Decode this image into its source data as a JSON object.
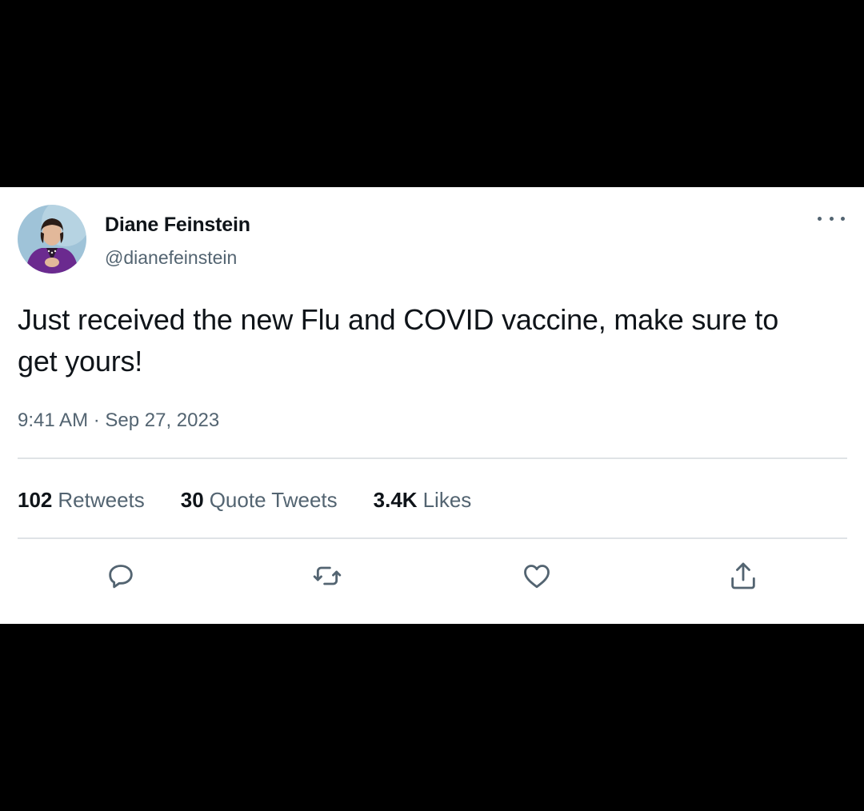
{
  "tweet": {
    "author_name": "Diane Feinstein",
    "author_handle": "@dianefeinstein",
    "text": "Just received the new Flu and COVID vaccine, make sure to get yours!",
    "timestamp": "9:41 AM · Sep 27, 2023"
  },
  "stats": {
    "retweets_count": "102",
    "retweets_label": "Retweets",
    "quotes_count": "30",
    "quotes_label": "Quote Tweets",
    "likes_count": "3.4K",
    "likes_label": "Likes"
  },
  "actions": [
    {
      "icon": "reply-icon"
    },
    {
      "icon": "retweet-icon"
    },
    {
      "icon": "like-icon"
    },
    {
      "icon": "share-icon"
    }
  ],
  "colors": {
    "primary_text": "#0f1419",
    "secondary_text": "#536471",
    "divider": "#dfe3e6",
    "background": "#ffffff",
    "letterbox": "#000000"
  }
}
